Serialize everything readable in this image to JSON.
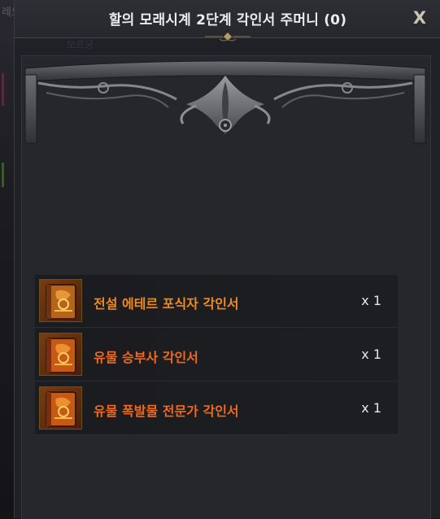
{
  "background": {
    "ghost_text": "레오",
    "ghost_text2": "보르궁"
  },
  "window": {
    "title": "할의 모래시계 2단계 각인서 주머니 (0)",
    "close_label": "X"
  },
  "items": [
    {
      "name": "전설 에테르 포식자 각인서",
      "qty": "x 1",
      "icon": "book-icon",
      "color": "#f18a1c"
    },
    {
      "name": "유물 승부사 각인서",
      "qty": "x 1",
      "icon": "book-icon",
      "color": "#f0681c"
    },
    {
      "name": "유물 폭발물 전문가 각인서",
      "qty": "x 1",
      "icon": "book-icon",
      "color": "#f0681c"
    }
  ],
  "colors": {
    "legendary": "#f18a1c",
    "relic": "#f0681c",
    "panel": "#25272d",
    "title_text": "#ececec"
  }
}
